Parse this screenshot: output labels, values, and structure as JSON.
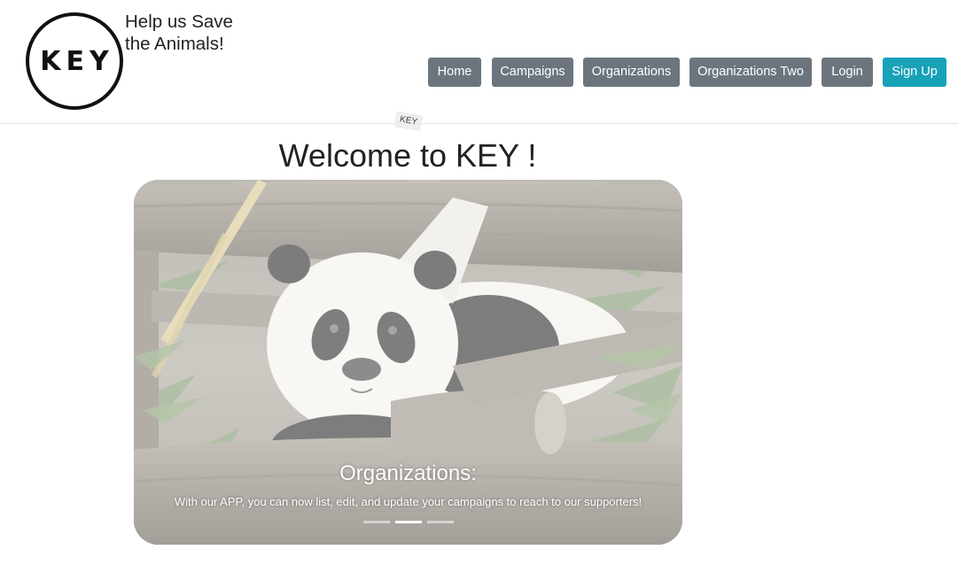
{
  "header": {
    "logo_text": "KEY",
    "tagline_line1": "Help us Save",
    "tagline_line2": "the Animals!",
    "nav": {
      "home": "Home",
      "campaigns": "Campaigns",
      "organizations": "Organizations",
      "organizations_two": "Organizations Two",
      "login": "Login",
      "signup": "Sign Up"
    }
  },
  "badge": "KEY",
  "main": {
    "title": "Welcome to KEY !",
    "carousel": {
      "caption_title": "Organizations:",
      "caption_text": "With our APP, you can now list, edit, and update your campaigns to reach to our supporters!",
      "slide_count": 3,
      "active_index": 1
    }
  },
  "colors": {
    "nav_button": "#6c757d",
    "signup_button": "#17a2b8"
  }
}
